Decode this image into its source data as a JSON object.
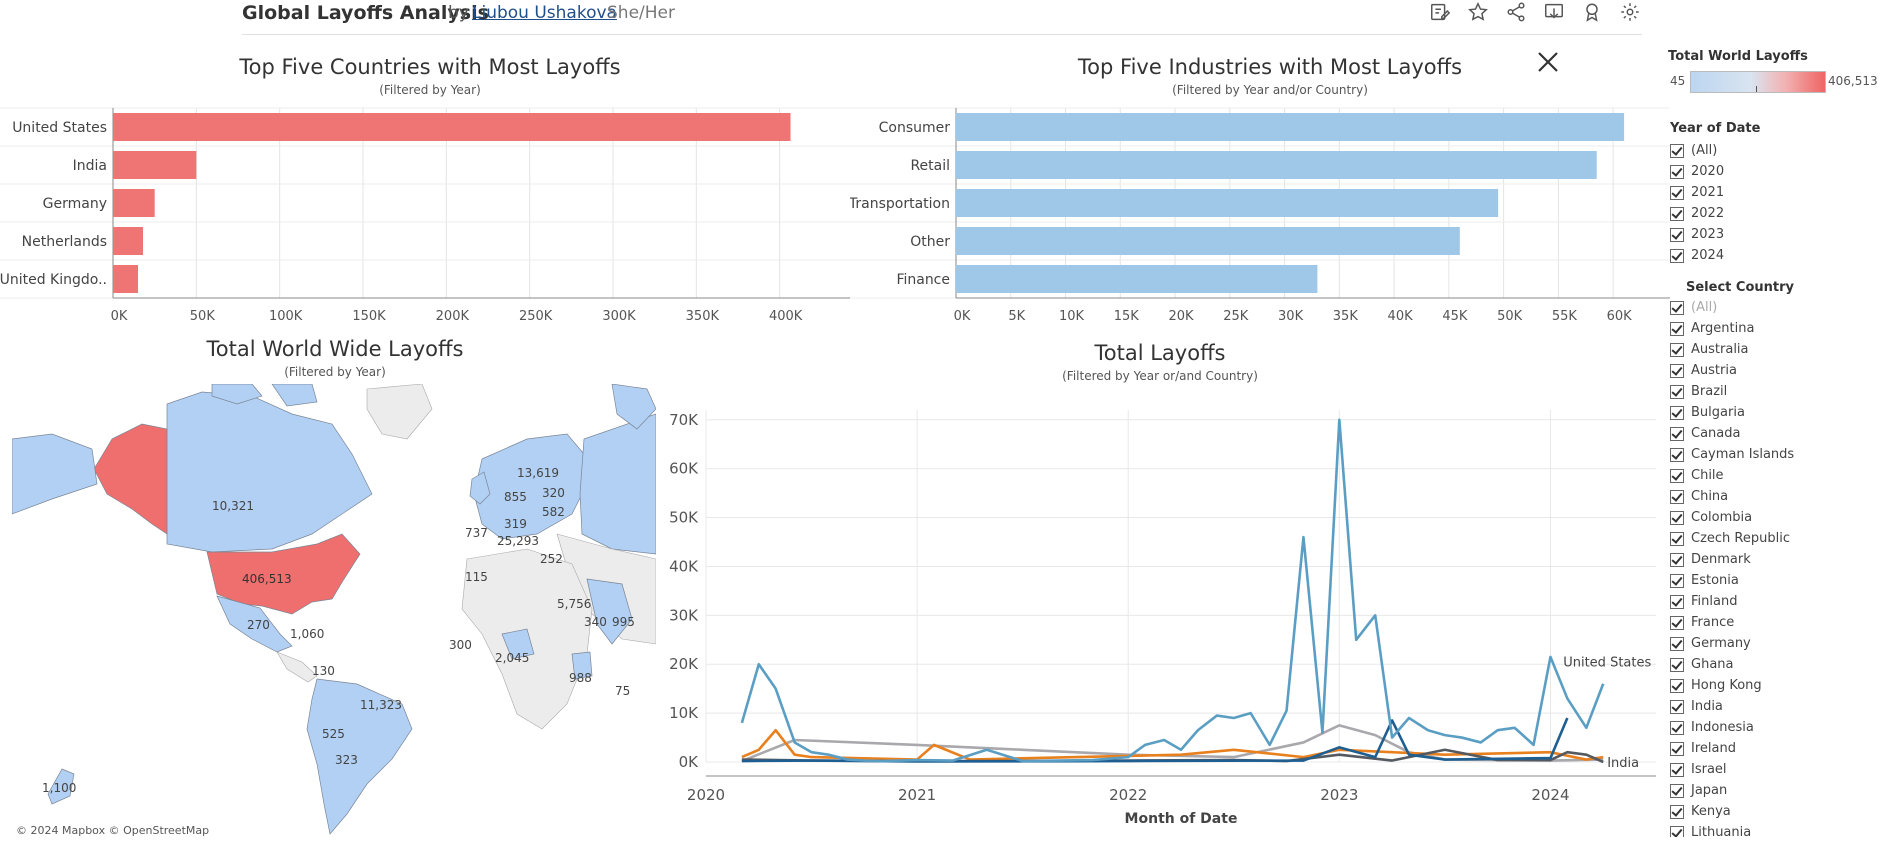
{
  "header": {
    "title": "Global Layoffs Analysis",
    "by": "by",
    "author": "Liubou Ushakova",
    "pronouns": "She/Her",
    "icons": [
      "edit-icon",
      "star-icon",
      "share-icon",
      "download-icon",
      "award-icon",
      "settings-icon"
    ]
  },
  "colors": {
    "red": "#ef7575",
    "blue": "#9fc8e8",
    "line_blue": "#5b9ec4",
    "orange": "#e8801e",
    "gray": "#a9a9ad",
    "dark_navy": "#1e5e91",
    "dark_gray": "#555a61"
  },
  "countries_chart": {
    "title": "Top Five Countries with Most Layoffs",
    "subtitle": "(Filtered by Year)",
    "tick_labels": [
      "0K",
      "50K",
      "100K",
      "150K",
      "200K",
      "250K",
      "300K",
      "350K",
      "400K"
    ],
    "chart_data": {
      "type": "bar",
      "categories": [
        "United States",
        "India",
        "Germany",
        "Netherlands",
        "United Kingdo.."
      ],
      "values": [
        406513,
        50000,
        25000,
        18000,
        15000
      ],
      "xlim": [
        0,
        420000
      ]
    }
  },
  "industries_chart": {
    "title": "Top Five Industries with Most Layoffs",
    "subtitle": "(Filtered by Year and/or Country)",
    "tick_labels": [
      "0K",
      "5K",
      "10K",
      "15K",
      "20K",
      "25K",
      "30K",
      "35K",
      "40K",
      "45K",
      "50K",
      "55K",
      "60K"
    ],
    "chart_data": {
      "type": "bar",
      "categories": [
        "Consumer",
        "Retail",
        "Transportation",
        "Other",
        "Finance"
      ],
      "values": [
        61000,
        58500,
        49500,
        46000,
        33000
      ],
      "xlim": [
        0,
        63000
      ]
    }
  },
  "map": {
    "title": "Total World Wide Layoffs",
    "subtitle": "(Filtered by Year)",
    "attribution": "© 2024 Mapbox  © OpenStreetMap",
    "labels": [
      "10,321",
      "406,513",
      "270",
      "1,060",
      "130",
      "11,323",
      "525",
      "323",
      "1,100",
      "13,619",
      "855",
      "320",
      "582",
      "737",
      "319",
      "25,293",
      "252",
      "115",
      "300",
      "2,045",
      "5,756",
      "340",
      "995",
      "988",
      "75"
    ]
  },
  "line_chart": {
    "title": "Total Layoffs",
    "subtitle": "(Filtered by Year or/and Country)",
    "xlabel": "Month of Date",
    "y_ticks": [
      "0K",
      "10K",
      "20K",
      "30K",
      "40K",
      "50K",
      "60K",
      "70K"
    ],
    "x_ticks": [
      "2020",
      "2021",
      "2022",
      "2023",
      "2024"
    ],
    "chart_data": {
      "type": "line",
      "xlabel": "Month of Date",
      "ylim": [
        0,
        72000
      ],
      "series": [
        {
          "name": "United States",
          "color": "#5b9ec4",
          "x": [
            2020.17,
            2020.25,
            2020.33,
            2020.42,
            2020.5,
            2020.58,
            2020.67,
            2020.75,
            2020.83,
            2020.92,
            2021.0,
            2021.17,
            2021.33,
            2021.5,
            2021.67,
            2021.83,
            2022.0,
            2022.08,
            2022.17,
            2022.25,
            2022.33,
            2022.42,
            2022.5,
            2022.58,
            2022.67,
            2022.75,
            2022.83,
            2022.92,
            2023.0,
            2023.08,
            2023.17,
            2023.25,
            2023.33,
            2023.42,
            2023.5,
            2023.58,
            2023.67,
            2023.75,
            2023.83,
            2023.92,
            2024.0,
            2024.08,
            2024.17,
            2024.25
          ],
          "y": [
            8000,
            20000,
            15000,
            4000,
            2000,
            1500,
            500,
            300,
            200,
            300,
            400,
            300,
            2500,
            200,
            300,
            400,
            1000,
            3500,
            4500,
            2500,
            6500,
            9500,
            9000,
            10000,
            3500,
            10500,
            46000,
            6000,
            70000,
            25000,
            30000,
            5000,
            9000,
            6500,
            5500,
            5000,
            4000,
            6500,
            7000,
            3500,
            21500,
            13000,
            7000,
            16000
          ]
        },
        {
          "name": "India",
          "color": "#555a61",
          "x": [
            2020.17,
            2020.5,
            2021.0,
            2021.5,
            2022.0,
            2022.5,
            2022.75,
            2023.0,
            2023.25,
            2023.5,
            2023.75,
            2024.0,
            2024.08,
            2024.17,
            2024.25
          ],
          "y": [
            500,
            300,
            200,
            200,
            300,
            400,
            200,
            1500,
            300,
            2500,
            400,
            400,
            2000,
            1500,
            0
          ]
        },
        {
          "name": "",
          "color": "#e8801e",
          "x": [
            2020.17,
            2020.25,
            2020.33,
            2020.42,
            2020.5,
            2021.0,
            2021.08,
            2021.25,
            2022.25,
            2022.5,
            2022.83,
            2023.0,
            2023.25,
            2023.5,
            2024.0,
            2024.17,
            2024.25
          ],
          "y": [
            1000,
            2500,
            6500,
            1500,
            1000,
            500,
            3500,
            500,
            1500,
            2500,
            1000,
            2500,
            2000,
            1500,
            2000,
            500,
            1000
          ]
        },
        {
          "name": "",
          "color": "#a9a9ad",
          "x": [
            2020.17,
            2020.42,
            2021.0,
            2021.5,
            2022.0,
            2022.5,
            2022.83,
            2023.0,
            2023.17,
            2023.33,
            2023.5,
            2024.0,
            2024.25
          ],
          "y": [
            200,
            4500,
            3500,
            2500,
            1500,
            1000,
            4000,
            7500,
            5500,
            2000,
            500,
            300,
            500
          ]
        },
        {
          "name": "",
          "color": "#1e5e91",
          "x": [
            2020.17,
            2020.5,
            2021.0,
            2022.0,
            2022.83,
            2023.0,
            2023.17,
            2023.25,
            2023.33,
            2023.5,
            2024.0,
            2024.08
          ],
          "y": [
            200,
            300,
            100,
            200,
            300,
            3000,
            1000,
            8500,
            1500,
            500,
            800,
            9000
          ]
        }
      ]
    }
  },
  "legend": {
    "title": "Total World Layoffs",
    "min": "45",
    "max": "406,513"
  },
  "year_filter": {
    "title": "Year of Date",
    "items": [
      "(All)",
      "2020",
      "2021",
      "2022",
      "2023",
      "2024"
    ]
  },
  "country_filter": {
    "title": "Select Country",
    "items": [
      "(All)",
      "Argentina",
      "Australia",
      "Austria",
      "Brazil",
      "Bulgaria",
      "Canada",
      "Cayman Islands",
      "Chile",
      "China",
      "Colombia",
      "Czech Republic",
      "Denmark",
      "Estonia",
      "Finland",
      "France",
      "Germany",
      "Ghana",
      "Hong Kong",
      "India",
      "Indonesia",
      "Ireland",
      "Israel",
      "Japan",
      "Kenya",
      "Lithuania"
    ]
  }
}
